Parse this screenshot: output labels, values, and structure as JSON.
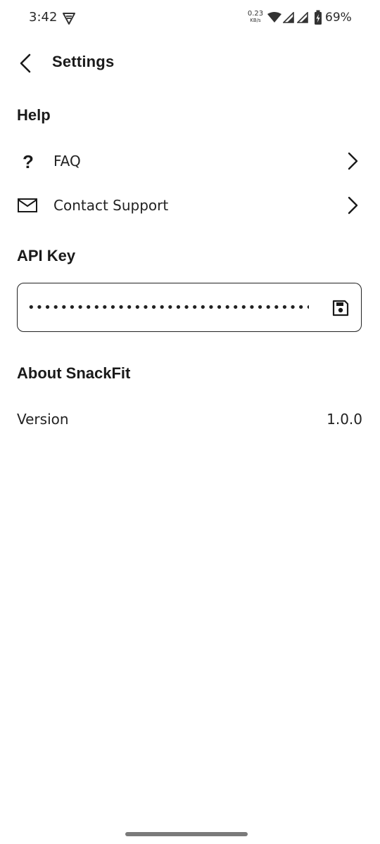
{
  "status_bar": {
    "time": "3:42",
    "net_speed_value": "0.23",
    "net_speed_unit": "KB/s",
    "battery_percent": "69%"
  },
  "header": {
    "title": "Settings",
    "back_icon": "chevron-left-icon"
  },
  "help": {
    "title": "Help",
    "items": [
      {
        "label": "FAQ",
        "icon": "question-icon"
      },
      {
        "label": "Contact Support",
        "icon": "mail-icon"
      }
    ]
  },
  "api_key": {
    "title": "API Key",
    "value": "•••••••••••••••••••••••••••••••••••••",
    "save_icon": "save-icon"
  },
  "about": {
    "title": "About SnackFit",
    "version_label": "Version",
    "version_value": "1.0.0"
  }
}
